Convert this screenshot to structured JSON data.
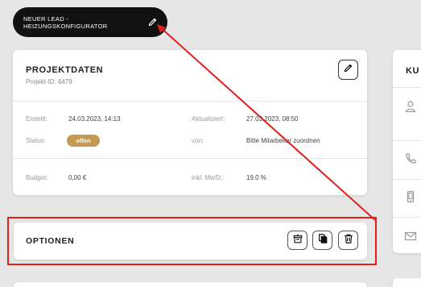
{
  "lead": {
    "title": "NEUER LEAD - HEIZUNGSKONFIGURATOR"
  },
  "projekt": {
    "title": "PROJEKTDATEN",
    "id_text": "Projekt-ID: 6479",
    "erstellt_label": "Erstellt:",
    "erstellt_value": "24.03.2023, 14:13",
    "aktualisiert_label": "Aktualisiert:",
    "aktualisiert_value": "27.03.2023, 08:50",
    "status_label": "Status:",
    "status_value": "offen",
    "von_label": "von:",
    "von_value": "Bitte Mitarbeiter zuordnen",
    "budget_label": "Budget:",
    "budget_value": "0,00 €",
    "mwst_label": "inkl. MwSt.:",
    "mwst_value": "19.0 %"
  },
  "optionen": {
    "title": "OPTIONEN"
  },
  "right": {
    "title_fragment": "KU"
  },
  "colors": {
    "status_badge": "#c49a52",
    "annotation": "#e0201a",
    "pill_bg": "#111111"
  },
  "icons": [
    "pencil-icon",
    "archive-icon",
    "copy-icon",
    "trash-icon",
    "user-icon",
    "phone-icon",
    "mobile-icon",
    "mail-icon"
  ]
}
